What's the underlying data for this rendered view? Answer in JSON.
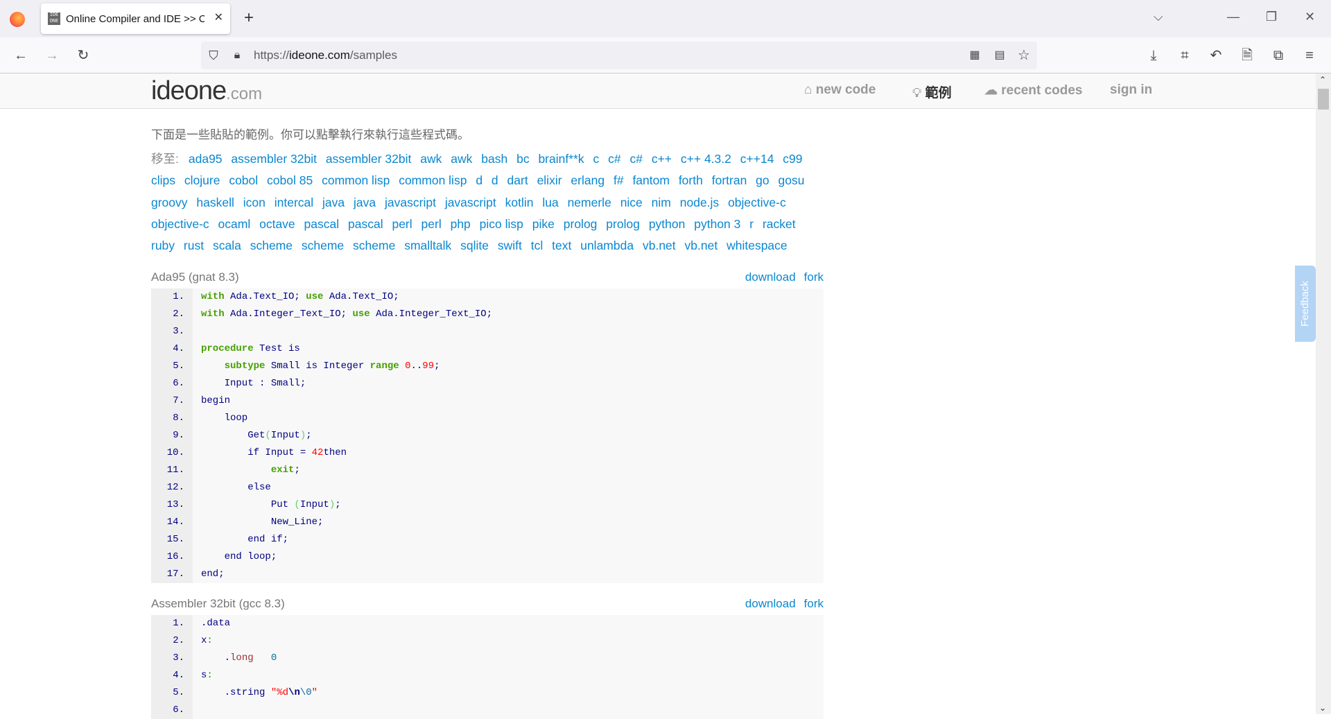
{
  "browser": {
    "tab_title": "Online Compiler and IDE >> C",
    "favicon": "IDE ONE",
    "url_prefix": "https://",
    "url_host": "ideone.com",
    "url_path": "/samples"
  },
  "site": {
    "logo_main": "ideone",
    "logo_suffix": ".com",
    "nav": [
      {
        "label": "new code",
        "icon": "home-icon"
      },
      {
        "label": "範例",
        "icon": "lightbulb-icon"
      },
      {
        "label": "recent codes",
        "icon": "cloud-icon"
      },
      {
        "label": "sign in"
      }
    ]
  },
  "intro": "下面是一些貼貼的範例。你可以點擊執行來執行這些程式碼。",
  "goto_label": "移至:",
  "languages": [
    "ada95",
    "assembler 32bit",
    "assembler 32bit",
    "awk",
    "awk",
    "bash",
    "bc",
    "brainf**k",
    "c",
    "c#",
    "c#",
    "c++",
    "c++ 4.3.2",
    "c++14",
    "c99",
    "clips",
    "clojure",
    "cobol",
    "cobol 85",
    "common lisp",
    "common lisp",
    "d",
    "d",
    "dart",
    "elixir",
    "erlang",
    "f#",
    "fantom",
    "forth",
    "fortran",
    "go",
    "gosu",
    "groovy",
    "haskell",
    "icon",
    "intercal",
    "java",
    "java",
    "javascript",
    "javascript",
    "kotlin",
    "lua",
    "nemerle",
    "nice",
    "nim",
    "node.js",
    "objective-c",
    "objective-c",
    "ocaml",
    "octave",
    "pascal",
    "pascal",
    "perl",
    "perl",
    "php",
    "pico lisp",
    "pike",
    "prolog",
    "prolog",
    "python",
    "python 3",
    "r",
    "racket",
    "ruby",
    "rust",
    "scala",
    "scheme",
    "scheme",
    "scheme",
    "smalltalk",
    "sqlite",
    "swift",
    "tcl",
    "text",
    "unlambda",
    "vb.net",
    "vb.net",
    "whitespace"
  ],
  "samples": [
    {
      "title": "Ada95 (gnat 8.3)",
      "download": "download",
      "fork": "fork",
      "lines": [
        [
          [
            "k",
            "with"
          ],
          [
            "",
            " Ada.Text_IO; "
          ],
          [
            "k",
            "use"
          ],
          [
            "",
            " Ada.Text_IO;"
          ]
        ],
        [
          [
            "k",
            "with"
          ],
          [
            "",
            " Ada.Integer_Text_IO; "
          ],
          [
            "k",
            "use"
          ],
          [
            "",
            " Ada.Integer_Text_IO;"
          ]
        ],
        [],
        [
          [
            "k",
            "procedure"
          ],
          [
            "",
            " Test is"
          ]
        ],
        [
          [
            "",
            "    "
          ],
          [
            "k",
            "subtype"
          ],
          [
            "",
            " Small is Integer "
          ],
          [
            "k",
            "range"
          ],
          [
            "n",
            " 0"
          ],
          [
            "",
            ".."
          ],
          [
            "n",
            "99"
          ],
          [
            "",
            ";"
          ]
        ],
        [
          [
            "",
            "    Input : Small;"
          ]
        ],
        [
          [
            "",
            "begin"
          ]
        ],
        [
          [
            "",
            "    loop"
          ]
        ],
        [
          [
            "",
            "        Get"
          ],
          [
            "p",
            "("
          ],
          [
            "",
            "Input"
          ],
          [
            "p",
            ")"
          ],
          [
            "",
            ";"
          ]
        ],
        [
          [
            "",
            "        if Input = "
          ],
          [
            "n",
            "42"
          ],
          [
            "",
            ""
          ],
          [
            "",
            "then"
          ]
        ],
        [
          [
            "",
            "            "
          ],
          [
            "k",
            "exit"
          ],
          [
            "",
            ";"
          ]
        ],
        [
          [
            "",
            "        else"
          ]
        ],
        [
          [
            "",
            "            Put "
          ],
          [
            "p",
            "("
          ],
          [
            "",
            "Input"
          ],
          [
            "p",
            ")"
          ],
          [
            "",
            ";"
          ]
        ],
        [
          [
            "",
            "            New_Line;"
          ]
        ],
        [
          [
            "",
            "        end if;"
          ]
        ],
        [
          [
            "",
            "    end loop;"
          ]
        ],
        [
          [
            "",
            "end;"
          ]
        ]
      ]
    },
    {
      "title": "Assembler 32bit (gcc 8.3)",
      "download": "download",
      "fork": "fork",
      "lines": [
        [
          [
            "",
            ".data"
          ]
        ],
        [
          [
            "",
            "x"
          ],
          [
            "g",
            ":"
          ]
        ],
        [
          [
            "",
            "    ."
          ],
          [
            "d",
            "long"
          ],
          [
            "",
            "   "
          ],
          [
            "o",
            "0"
          ]
        ],
        [
          [
            "",
            "s"
          ],
          [
            "g",
            ":"
          ]
        ],
        [
          [
            "",
            "    .string "
          ],
          [
            "s",
            "\"%d"
          ],
          [
            "e",
            "\\n"
          ],
          [
            "o",
            "\\0"
          ],
          [
            "s",
            "\""
          ]
        ],
        []
      ]
    }
  ],
  "feedback": "Feedback"
}
